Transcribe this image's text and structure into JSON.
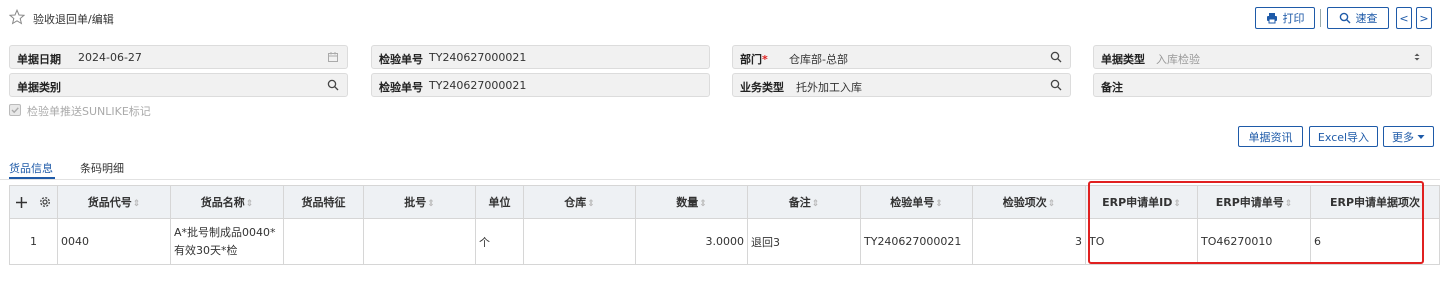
{
  "header": {
    "title": "验收退回单/编辑",
    "print_label": "打印",
    "search_label": "速查",
    "prev_label": "<",
    "next_label": ">"
  },
  "form": {
    "doc_date": {
      "label": "单据日期",
      "value": "2024-06-27"
    },
    "inspect_no_1": {
      "label": "检验单号",
      "value": "TY240627000021"
    },
    "department": {
      "label": "部门",
      "required_mark": "*",
      "value": "仓库部-总部"
    },
    "doc_type": {
      "label": "单据类型",
      "placeholder": "入库检验"
    },
    "doc_category": {
      "label": "单据类别",
      "value": ""
    },
    "inspect_no_2": {
      "label": "检验单号",
      "value": "TY240627000021"
    },
    "business_type": {
      "label": "业务类型",
      "value": "托外加工入库"
    },
    "remark": {
      "label": "备注",
      "value": ""
    }
  },
  "sunlike_checkbox": {
    "label": "检验单推送SUNLIKE标记",
    "checked": true
  },
  "actions": {
    "doc_info": "单据资讯",
    "excel_import": "Excel导入",
    "more": "更多"
  },
  "tabs": [
    {
      "label": "货品信息",
      "active": true
    },
    {
      "label": "条码明细",
      "active": false
    }
  ],
  "table": {
    "columns": [
      {
        "label": "货品代号",
        "sortable": true
      },
      {
        "label": "货品名称",
        "sortable": true
      },
      {
        "label": "货品特征",
        "sortable": false
      },
      {
        "label": "批号",
        "sortable": true
      },
      {
        "label": "单位",
        "sortable": false
      },
      {
        "label": "仓库",
        "sortable": true
      },
      {
        "label": "数量",
        "sortable": true
      },
      {
        "label": "备注",
        "sortable": true
      },
      {
        "label": "检验单号",
        "sortable": true
      },
      {
        "label": "检验项次",
        "sortable": true
      },
      {
        "label": "ERP申请单ID",
        "sortable": true
      },
      {
        "label": "ERP申请单号",
        "sortable": true
      },
      {
        "label": "ERP申请单据项次",
        "sortable": false
      }
    ],
    "rows": [
      {
        "index": "1",
        "item_code": "0040",
        "item_name_line1": "A*批号制成品0040*",
        "item_name_line2": "有效30天*检",
        "feature": "",
        "batch": "",
        "unit": "个",
        "warehouse": "",
        "quantity": "3.0000",
        "remark": "退回3",
        "inspect_no": "TY240627000021",
        "inspect_seq": "3",
        "erp_req_id": "TO",
        "erp_req_no": "TO46270010",
        "erp_req_seq": "6"
      }
    ]
  },
  "colors": {
    "accent": "#1e5aa8",
    "highlight": "#e02020",
    "header_bg": "#eef1f4",
    "field_bg": "#f1f1f1"
  }
}
